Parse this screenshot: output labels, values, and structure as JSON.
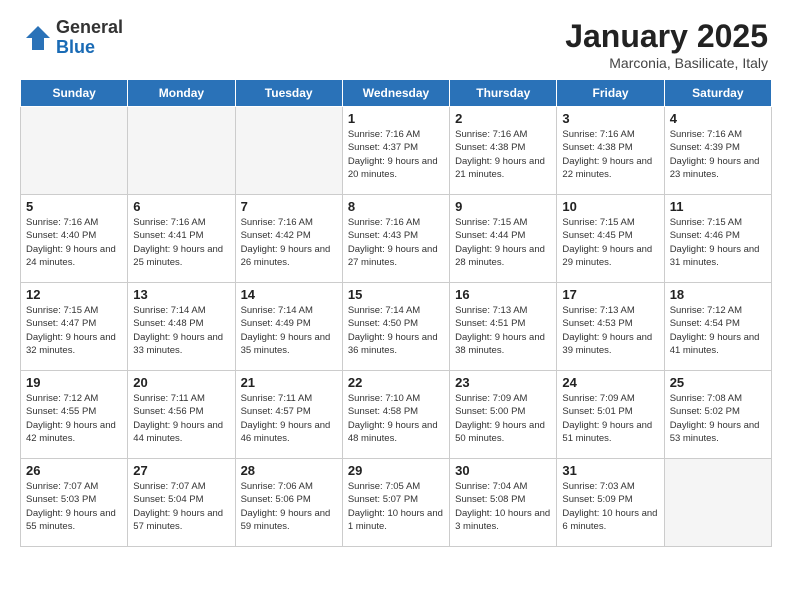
{
  "header": {
    "logo_general": "General",
    "logo_blue": "Blue",
    "month": "January 2025",
    "location": "Marconia, Basilicate, Italy"
  },
  "weekdays": [
    "Sunday",
    "Monday",
    "Tuesday",
    "Wednesday",
    "Thursday",
    "Friday",
    "Saturday"
  ],
  "weeks": [
    [
      {
        "day": "",
        "info": "",
        "empty": true
      },
      {
        "day": "",
        "info": "",
        "empty": true
      },
      {
        "day": "",
        "info": "",
        "empty": true
      },
      {
        "day": "1",
        "info": "Sunrise: 7:16 AM\nSunset: 4:37 PM\nDaylight: 9 hours\nand 20 minutes."
      },
      {
        "day": "2",
        "info": "Sunrise: 7:16 AM\nSunset: 4:38 PM\nDaylight: 9 hours\nand 21 minutes."
      },
      {
        "day": "3",
        "info": "Sunrise: 7:16 AM\nSunset: 4:38 PM\nDaylight: 9 hours\nand 22 minutes."
      },
      {
        "day": "4",
        "info": "Sunrise: 7:16 AM\nSunset: 4:39 PM\nDaylight: 9 hours\nand 23 minutes."
      }
    ],
    [
      {
        "day": "5",
        "info": "Sunrise: 7:16 AM\nSunset: 4:40 PM\nDaylight: 9 hours\nand 24 minutes."
      },
      {
        "day": "6",
        "info": "Sunrise: 7:16 AM\nSunset: 4:41 PM\nDaylight: 9 hours\nand 25 minutes."
      },
      {
        "day": "7",
        "info": "Sunrise: 7:16 AM\nSunset: 4:42 PM\nDaylight: 9 hours\nand 26 minutes."
      },
      {
        "day": "8",
        "info": "Sunrise: 7:16 AM\nSunset: 4:43 PM\nDaylight: 9 hours\nand 27 minutes."
      },
      {
        "day": "9",
        "info": "Sunrise: 7:15 AM\nSunset: 4:44 PM\nDaylight: 9 hours\nand 28 minutes."
      },
      {
        "day": "10",
        "info": "Sunrise: 7:15 AM\nSunset: 4:45 PM\nDaylight: 9 hours\nand 29 minutes."
      },
      {
        "day": "11",
        "info": "Sunrise: 7:15 AM\nSunset: 4:46 PM\nDaylight: 9 hours\nand 31 minutes."
      }
    ],
    [
      {
        "day": "12",
        "info": "Sunrise: 7:15 AM\nSunset: 4:47 PM\nDaylight: 9 hours\nand 32 minutes."
      },
      {
        "day": "13",
        "info": "Sunrise: 7:14 AM\nSunset: 4:48 PM\nDaylight: 9 hours\nand 33 minutes."
      },
      {
        "day": "14",
        "info": "Sunrise: 7:14 AM\nSunset: 4:49 PM\nDaylight: 9 hours\nand 35 minutes."
      },
      {
        "day": "15",
        "info": "Sunrise: 7:14 AM\nSunset: 4:50 PM\nDaylight: 9 hours\nand 36 minutes."
      },
      {
        "day": "16",
        "info": "Sunrise: 7:13 AM\nSunset: 4:51 PM\nDaylight: 9 hours\nand 38 minutes."
      },
      {
        "day": "17",
        "info": "Sunrise: 7:13 AM\nSunset: 4:53 PM\nDaylight: 9 hours\nand 39 minutes."
      },
      {
        "day": "18",
        "info": "Sunrise: 7:12 AM\nSunset: 4:54 PM\nDaylight: 9 hours\nand 41 minutes."
      }
    ],
    [
      {
        "day": "19",
        "info": "Sunrise: 7:12 AM\nSunset: 4:55 PM\nDaylight: 9 hours\nand 42 minutes."
      },
      {
        "day": "20",
        "info": "Sunrise: 7:11 AM\nSunset: 4:56 PM\nDaylight: 9 hours\nand 44 minutes."
      },
      {
        "day": "21",
        "info": "Sunrise: 7:11 AM\nSunset: 4:57 PM\nDaylight: 9 hours\nand 46 minutes."
      },
      {
        "day": "22",
        "info": "Sunrise: 7:10 AM\nSunset: 4:58 PM\nDaylight: 9 hours\nand 48 minutes."
      },
      {
        "day": "23",
        "info": "Sunrise: 7:09 AM\nSunset: 5:00 PM\nDaylight: 9 hours\nand 50 minutes."
      },
      {
        "day": "24",
        "info": "Sunrise: 7:09 AM\nSunset: 5:01 PM\nDaylight: 9 hours\nand 51 minutes."
      },
      {
        "day": "25",
        "info": "Sunrise: 7:08 AM\nSunset: 5:02 PM\nDaylight: 9 hours\nand 53 minutes."
      }
    ],
    [
      {
        "day": "26",
        "info": "Sunrise: 7:07 AM\nSunset: 5:03 PM\nDaylight: 9 hours\nand 55 minutes."
      },
      {
        "day": "27",
        "info": "Sunrise: 7:07 AM\nSunset: 5:04 PM\nDaylight: 9 hours\nand 57 minutes."
      },
      {
        "day": "28",
        "info": "Sunrise: 7:06 AM\nSunset: 5:06 PM\nDaylight: 9 hours\nand 59 minutes."
      },
      {
        "day": "29",
        "info": "Sunrise: 7:05 AM\nSunset: 5:07 PM\nDaylight: 10 hours\nand 1 minute."
      },
      {
        "day": "30",
        "info": "Sunrise: 7:04 AM\nSunset: 5:08 PM\nDaylight: 10 hours\nand 3 minutes."
      },
      {
        "day": "31",
        "info": "Sunrise: 7:03 AM\nSunset: 5:09 PM\nDaylight: 10 hours\nand 6 minutes."
      },
      {
        "day": "",
        "info": "",
        "empty": true
      }
    ]
  ]
}
